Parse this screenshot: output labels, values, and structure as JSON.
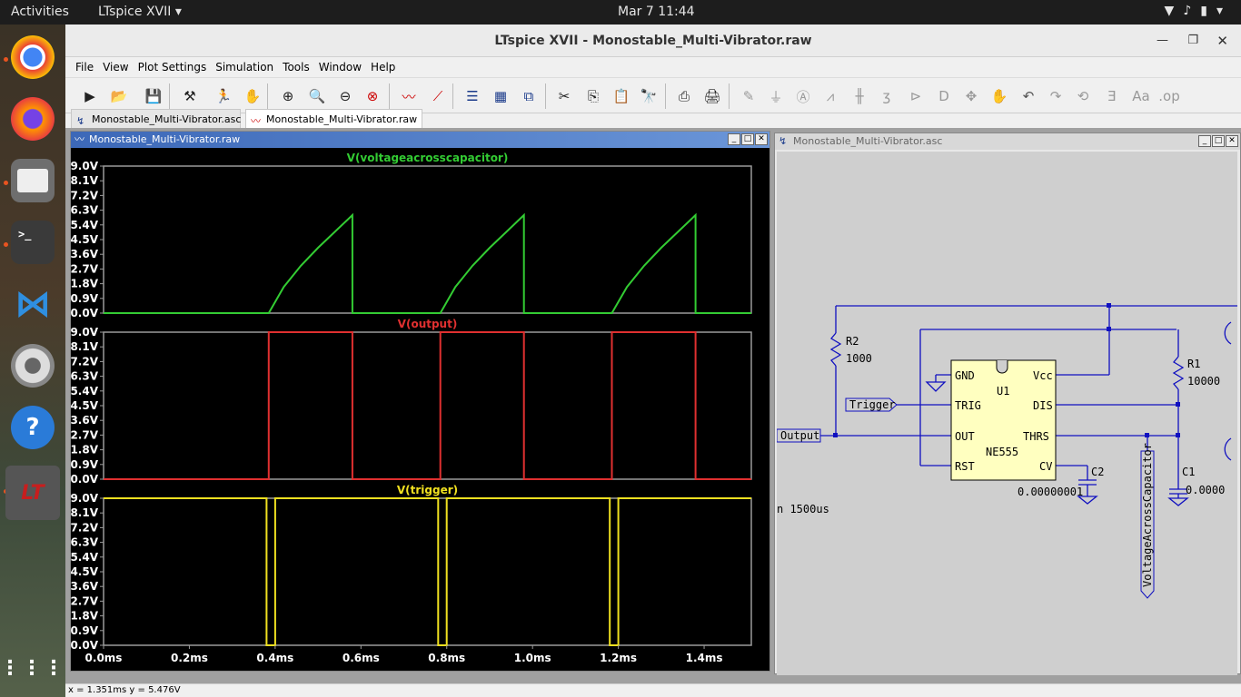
{
  "topbar": {
    "activities": "Activities",
    "app_menu": "LTspice XVII",
    "clock": "Mar 7  11:44"
  },
  "window": {
    "title": "LTspice XVII - Monostable_Multi-Vibrator.raw"
  },
  "menu": [
    "File",
    "View",
    "Plot Settings",
    "Simulation",
    "Tools",
    "Window",
    "Help"
  ],
  "tabs": [
    {
      "label": "Monostable_Multi-Vibrator.asc",
      "active": false
    },
    {
      "label": "Monostable_Multi-Vibrator.raw",
      "active": true
    }
  ],
  "plot_window": {
    "title": "Monostable_Multi-Vibrator.raw"
  },
  "schematic_window": {
    "title": "Monostable_Multi-Vibrator.asc"
  },
  "chart_data": [
    {
      "type": "line",
      "title": "V(voltageacrosscapacitor)",
      "color": "#33cc33",
      "yticks": [
        "9.0V",
        "8.1V",
        "7.2V",
        "6.3V",
        "5.4V",
        "4.5V",
        "3.6V",
        "2.7V",
        "1.8V",
        "0.9V",
        "0.0V"
      ],
      "ylim": [
        0,
        9
      ],
      "xlim": [
        0,
        1.51
      ],
      "series": [
        {
          "x": [
            0,
            0.385,
            0.42,
            0.46,
            0.5,
            0.54,
            0.58,
            0.58,
            0.785,
            0.82,
            0.86,
            0.9,
            0.94,
            0.98,
            0.98,
            1.185,
            1.22,
            1.26,
            1.3,
            1.34,
            1.38,
            1.38,
            1.51
          ],
          "y": [
            0,
            0,
            1.6,
            2.9,
            4.0,
            5.0,
            6.0,
            0,
            0,
            1.6,
            2.9,
            4.0,
            5.0,
            6.0,
            0,
            0,
            1.6,
            2.9,
            4.0,
            5.0,
            6.0,
            0,
            0
          ]
        }
      ]
    },
    {
      "type": "line",
      "title": "V(output)",
      "color": "#e03030",
      "yticks": [
        "9.0V",
        "8.1V",
        "7.2V",
        "6.3V",
        "5.4V",
        "4.5V",
        "3.6V",
        "2.7V",
        "1.8V",
        "0.9V",
        "0.0V"
      ],
      "ylim": [
        0,
        9
      ],
      "xlim": [
        0,
        1.51
      ],
      "series": [
        {
          "x": [
            0,
            0.385,
            0.385,
            0.58,
            0.58,
            0.785,
            0.785,
            0.98,
            0.98,
            1.185,
            1.185,
            1.38,
            1.38,
            1.51
          ],
          "y": [
            0,
            0,
            9,
            9,
            0,
            0,
            9,
            9,
            0,
            0,
            9,
            9,
            0,
            0
          ]
        }
      ]
    },
    {
      "type": "line",
      "title": "V(trigger)",
      "color": "#f0e020",
      "yticks": [
        "9.0V",
        "8.1V",
        "7.2V",
        "6.3V",
        "5.4V",
        "4.5V",
        "3.6V",
        "2.7V",
        "1.8V",
        "0.9V",
        "0.0V"
      ],
      "xticks": [
        "0.0ms",
        "0.2ms",
        "0.4ms",
        "0.6ms",
        "0.8ms",
        "1.0ms",
        "1.2ms",
        "1.4ms"
      ],
      "ylim": [
        0,
        9
      ],
      "xlim": [
        0,
        1.51
      ],
      "series": [
        {
          "x": [
            0,
            0.38,
            0.38,
            0.4,
            0.4,
            0.78,
            0.78,
            0.8,
            0.8,
            1.18,
            1.18,
            1.2,
            1.2,
            1.51
          ],
          "y": [
            9,
            9,
            0,
            0,
            9,
            9,
            0,
            0,
            9,
            9,
            0,
            0,
            9,
            9
          ]
        }
      ]
    }
  ],
  "schematic": {
    "r2_name": "R2",
    "r2_value": "1000",
    "r1_name": "R1",
    "r1_value": "10000",
    "u1_name": "U1",
    "u1_part": "NE555",
    "pin_gnd": "GND",
    "pin_vcc": "Vcc",
    "pin_trig": "TRIG",
    "pin_dis": "DIS",
    "pin_out": "OUT",
    "pin_thrs": "THRS",
    "pin_rst": "RST",
    "pin_cv": "CV",
    "trigger_label": "Trigger",
    "output_label": "Output",
    "c2_name": "C2",
    "c2_value": "0.00000001",
    "c1_name": "C1",
    "c1_value": "0.0000",
    "vcap_label": "VoltageAcrossCapacitor",
    "sim_cmd": "n 1500us"
  },
  "status": "x = 1.351ms    y = 5.476V"
}
